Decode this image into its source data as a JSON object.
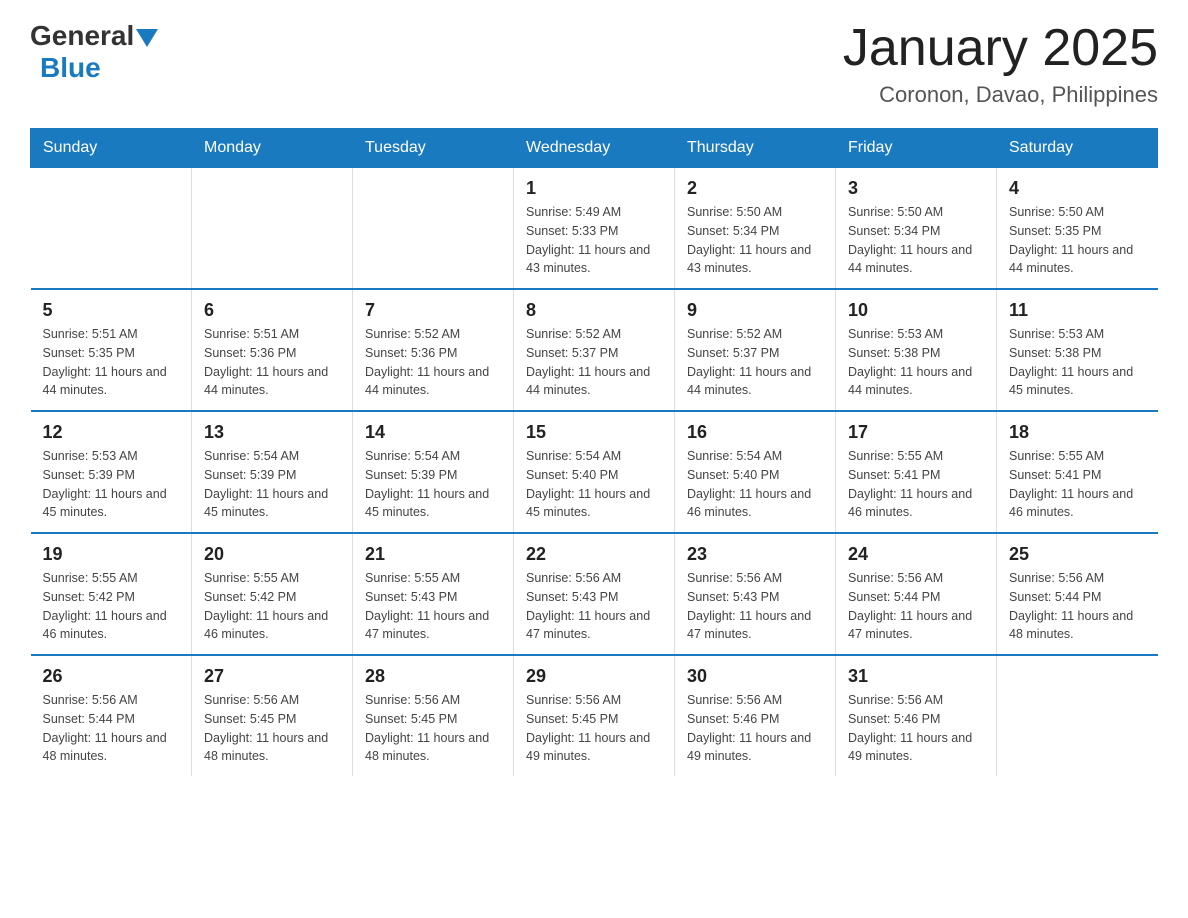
{
  "logo": {
    "general": "General",
    "arrow": "▲",
    "blue": "Blue"
  },
  "title": "January 2025",
  "location": "Coronon, Davao, Philippines",
  "headers": [
    "Sunday",
    "Monday",
    "Tuesday",
    "Wednesday",
    "Thursday",
    "Friday",
    "Saturday"
  ],
  "weeks": [
    [
      {
        "day": "",
        "info": ""
      },
      {
        "day": "",
        "info": ""
      },
      {
        "day": "",
        "info": ""
      },
      {
        "day": "1",
        "info": "Sunrise: 5:49 AM\nSunset: 5:33 PM\nDaylight: 11 hours and 43 minutes."
      },
      {
        "day": "2",
        "info": "Sunrise: 5:50 AM\nSunset: 5:34 PM\nDaylight: 11 hours and 43 minutes."
      },
      {
        "day": "3",
        "info": "Sunrise: 5:50 AM\nSunset: 5:34 PM\nDaylight: 11 hours and 44 minutes."
      },
      {
        "day": "4",
        "info": "Sunrise: 5:50 AM\nSunset: 5:35 PM\nDaylight: 11 hours and 44 minutes."
      }
    ],
    [
      {
        "day": "5",
        "info": "Sunrise: 5:51 AM\nSunset: 5:35 PM\nDaylight: 11 hours and 44 minutes."
      },
      {
        "day": "6",
        "info": "Sunrise: 5:51 AM\nSunset: 5:36 PM\nDaylight: 11 hours and 44 minutes."
      },
      {
        "day": "7",
        "info": "Sunrise: 5:52 AM\nSunset: 5:36 PM\nDaylight: 11 hours and 44 minutes."
      },
      {
        "day": "8",
        "info": "Sunrise: 5:52 AM\nSunset: 5:37 PM\nDaylight: 11 hours and 44 minutes."
      },
      {
        "day": "9",
        "info": "Sunrise: 5:52 AM\nSunset: 5:37 PM\nDaylight: 11 hours and 44 minutes."
      },
      {
        "day": "10",
        "info": "Sunrise: 5:53 AM\nSunset: 5:38 PM\nDaylight: 11 hours and 44 minutes."
      },
      {
        "day": "11",
        "info": "Sunrise: 5:53 AM\nSunset: 5:38 PM\nDaylight: 11 hours and 45 minutes."
      }
    ],
    [
      {
        "day": "12",
        "info": "Sunrise: 5:53 AM\nSunset: 5:39 PM\nDaylight: 11 hours and 45 minutes."
      },
      {
        "day": "13",
        "info": "Sunrise: 5:54 AM\nSunset: 5:39 PM\nDaylight: 11 hours and 45 minutes."
      },
      {
        "day": "14",
        "info": "Sunrise: 5:54 AM\nSunset: 5:39 PM\nDaylight: 11 hours and 45 minutes."
      },
      {
        "day": "15",
        "info": "Sunrise: 5:54 AM\nSunset: 5:40 PM\nDaylight: 11 hours and 45 minutes."
      },
      {
        "day": "16",
        "info": "Sunrise: 5:54 AM\nSunset: 5:40 PM\nDaylight: 11 hours and 46 minutes."
      },
      {
        "day": "17",
        "info": "Sunrise: 5:55 AM\nSunset: 5:41 PM\nDaylight: 11 hours and 46 minutes."
      },
      {
        "day": "18",
        "info": "Sunrise: 5:55 AM\nSunset: 5:41 PM\nDaylight: 11 hours and 46 minutes."
      }
    ],
    [
      {
        "day": "19",
        "info": "Sunrise: 5:55 AM\nSunset: 5:42 PM\nDaylight: 11 hours and 46 minutes."
      },
      {
        "day": "20",
        "info": "Sunrise: 5:55 AM\nSunset: 5:42 PM\nDaylight: 11 hours and 46 minutes."
      },
      {
        "day": "21",
        "info": "Sunrise: 5:55 AM\nSunset: 5:43 PM\nDaylight: 11 hours and 47 minutes."
      },
      {
        "day": "22",
        "info": "Sunrise: 5:56 AM\nSunset: 5:43 PM\nDaylight: 11 hours and 47 minutes."
      },
      {
        "day": "23",
        "info": "Sunrise: 5:56 AM\nSunset: 5:43 PM\nDaylight: 11 hours and 47 minutes."
      },
      {
        "day": "24",
        "info": "Sunrise: 5:56 AM\nSunset: 5:44 PM\nDaylight: 11 hours and 47 minutes."
      },
      {
        "day": "25",
        "info": "Sunrise: 5:56 AM\nSunset: 5:44 PM\nDaylight: 11 hours and 48 minutes."
      }
    ],
    [
      {
        "day": "26",
        "info": "Sunrise: 5:56 AM\nSunset: 5:44 PM\nDaylight: 11 hours and 48 minutes."
      },
      {
        "day": "27",
        "info": "Sunrise: 5:56 AM\nSunset: 5:45 PM\nDaylight: 11 hours and 48 minutes."
      },
      {
        "day": "28",
        "info": "Sunrise: 5:56 AM\nSunset: 5:45 PM\nDaylight: 11 hours and 48 minutes."
      },
      {
        "day": "29",
        "info": "Sunrise: 5:56 AM\nSunset: 5:45 PM\nDaylight: 11 hours and 49 minutes."
      },
      {
        "day": "30",
        "info": "Sunrise: 5:56 AM\nSunset: 5:46 PM\nDaylight: 11 hours and 49 minutes."
      },
      {
        "day": "31",
        "info": "Sunrise: 5:56 AM\nSunset: 5:46 PM\nDaylight: 11 hours and 49 minutes."
      },
      {
        "day": "",
        "info": ""
      }
    ]
  ]
}
